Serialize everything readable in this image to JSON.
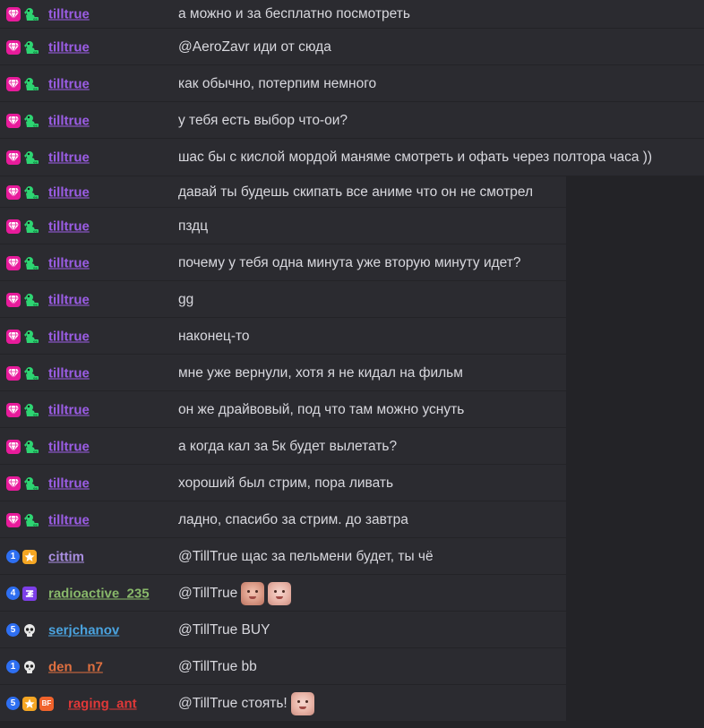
{
  "colors": {
    "background": "#232327",
    "row_bg": "#2b2b30",
    "message_text": "#d8d8de",
    "user_purple": "#9b5de5",
    "user_olive": "#88b86a",
    "user_blue": "#4aa3df",
    "user_orange": "#e07040",
    "user_red": "#e03838",
    "user_lavender": "#a98ee0"
  },
  "messages": [
    {
      "user": "tilltrue",
      "text": "а можно и за бесплатно посмотреть"
    },
    {
      "user": "tilltrue",
      "text": "@AeroZavr иди от сюда"
    },
    {
      "user": "tilltrue",
      "text": "как обычно, потерпим немного"
    },
    {
      "user": "tilltrue",
      "text": "у тебя есть выбор что-ои?"
    },
    {
      "user": "tilltrue",
      "text": "шас бы с кислой мордой маняме смотреть и офать через полтора часа ))"
    },
    {
      "user": "tilltrue",
      "text": "давай ты будешь скипать все аниме что он не смотрел"
    },
    {
      "user": "tilltrue",
      "text": "пздц"
    },
    {
      "user": "tilltrue",
      "text": "почему у тебя одна минута уже вторую минуту идет?"
    },
    {
      "user": "tilltrue",
      "text": "gg"
    },
    {
      "user": "tilltrue",
      "text": "наконец-то"
    },
    {
      "user": "tilltrue",
      "text": "мне уже вернули, хотя я не кидал на фильм"
    },
    {
      "user": "tilltrue",
      "text": "он же драйвовый, под что там можно уснуть"
    },
    {
      "user": "tilltrue",
      "text": "а когда кал за 5к будет вылетать?"
    },
    {
      "user": "tilltrue",
      "text": "хороший был стрим, пора ливать"
    },
    {
      "user": "tilltrue",
      "text": "ладно, спасибо за стрим. до завтра"
    },
    {
      "user": "cittim",
      "sub": "1",
      "text": "@TillTrue щас за пельмени будет, ты чё"
    },
    {
      "user": "radioactive_235",
      "sub": "4",
      "text": "@TillTrue"
    },
    {
      "user": "serjchanov",
      "sub": "5",
      "text": "@TillTrue BUY"
    },
    {
      "user": "den__n7",
      "sub": "1",
      "text": "@TillTrue bb"
    },
    {
      "user": "raging_ant",
      "sub": "5",
      "bf": "BF",
      "text": "@TillTrue стоять!"
    }
  ]
}
